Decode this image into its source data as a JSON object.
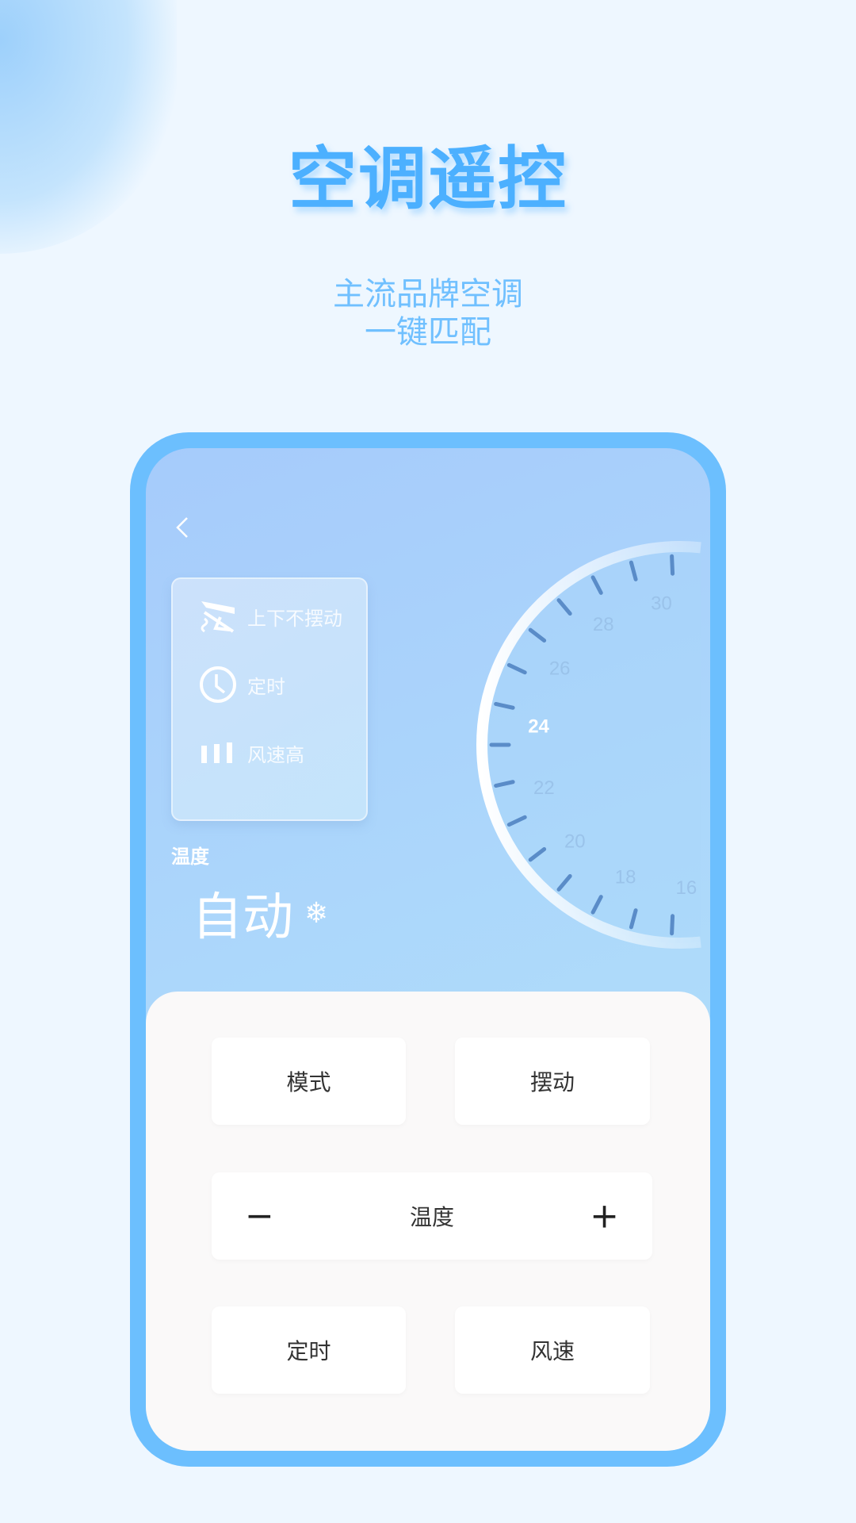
{
  "header": {
    "title": "空调遥控",
    "subtitle_line1": "主流品牌空调",
    "subtitle_line2": "一键匹配"
  },
  "colors": {
    "accent": "#4cb0ff",
    "frame": "#6cbffe",
    "tick": "#5a8cc8"
  },
  "remote": {
    "status_card": [
      {
        "icon": "swing-off-icon",
        "label": "上下不摆动"
      },
      {
        "icon": "clock-icon",
        "label": "定时"
      },
      {
        "icon": "fan-speed-bars-icon",
        "label": "风速高"
      }
    ],
    "temperature_label": "温度",
    "mode_value": "自动",
    "mode_icon": "snowflake-icon",
    "mode_icon_glyph": "❄",
    "dial": {
      "min": 16,
      "max": 30,
      "current": 24,
      "labels": [
        "16",
        "18",
        "20",
        "22",
        "24",
        "26",
        "28",
        "30"
      ]
    },
    "buttons": {
      "mode": "模式",
      "swing": "摆动",
      "temperature": "温度",
      "minus": "−",
      "plus": "+",
      "timer": "定时",
      "fan_speed": "风速"
    }
  }
}
